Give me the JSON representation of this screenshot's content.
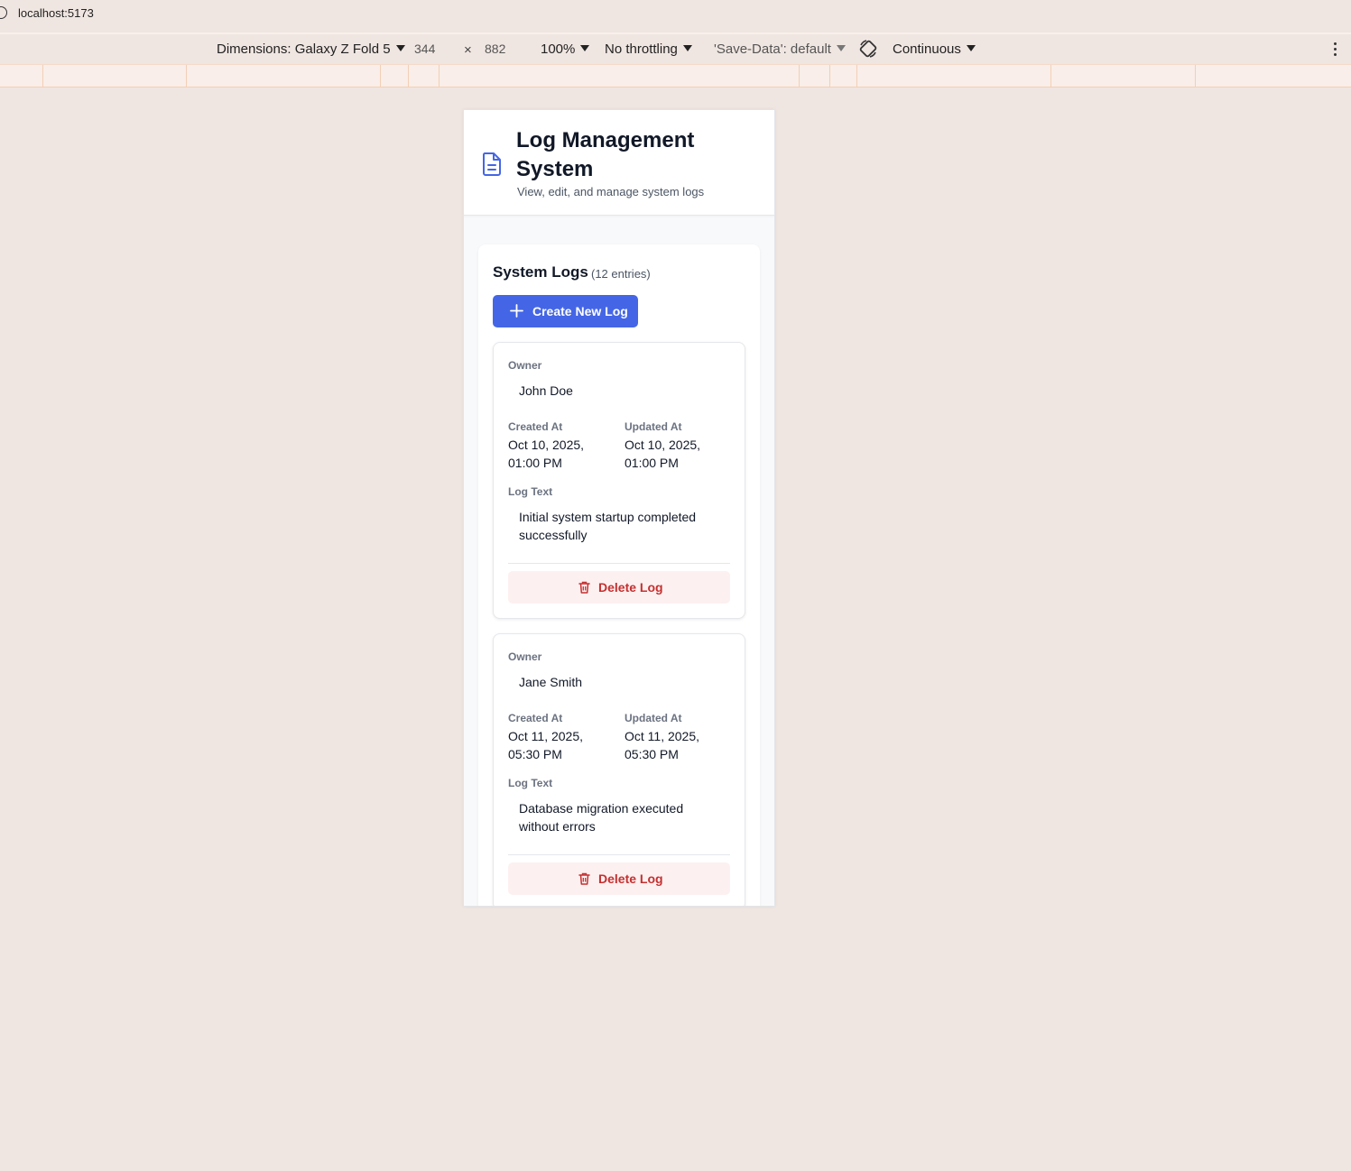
{
  "browser": {
    "url": "localhost:5173"
  },
  "device_toolbar": {
    "dimensions_label": "Dimensions: Galaxy Z Fold 5",
    "width": "344",
    "times": "×",
    "height": "882",
    "zoom": "100%",
    "throttling": "No throttling",
    "save_data": "'Save-Data': default",
    "mode": "Continuous"
  },
  "app": {
    "title": "Log Management System",
    "subtitle": "View, edit, and manage system logs",
    "accent_color": "#4466e6",
    "danger_color": "#c53030"
  },
  "logs_panel": {
    "title": "System Logs",
    "count": "(12 entries)",
    "create_button": "Create New Log",
    "labels": {
      "owner": "Owner",
      "created_at": "Created At",
      "updated_at": "Updated At",
      "log_text": "Log Text",
      "delete": "Delete Log"
    },
    "logs": [
      {
        "owner": "John Doe",
        "created_at": "Oct 10, 2025, 01:00 PM",
        "updated_at": "Oct 10, 2025, 01:00 PM",
        "text": "Initial system startup completed successfully"
      },
      {
        "owner": "Jane Smith",
        "created_at": "Oct 11, 2025, 05:30 PM",
        "updated_at": "Oct 11, 2025, 05:30 PM",
        "text": "Database migration executed without errors"
      }
    ]
  }
}
